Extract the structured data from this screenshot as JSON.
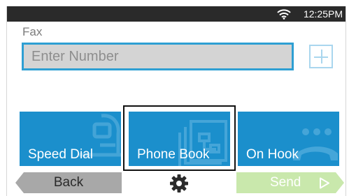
{
  "status_bar": {
    "time": "12:25PM",
    "wifi_icon": "wifi-icon"
  },
  "fax": {
    "label": "Fax",
    "number_placeholder": "Enter Number",
    "number_value": "",
    "add_icon": "plus-icon"
  },
  "tiles": [
    {
      "label": "Speed Dial",
      "icon": "speed-dial-icon"
    },
    {
      "label": "Phone Book",
      "icon": "phone-book-icon",
      "focused": true
    },
    {
      "label": "On Hook",
      "icon": "on-hook-icon"
    }
  ],
  "bottom_bar": {
    "back_label": "Back",
    "settings_icon": "gear-icon",
    "send_label": "Send",
    "send_icon": "play-arrow-icon"
  },
  "colors": {
    "accent": "#2e9fd3",
    "tile": "#1b8fcc",
    "send_disabled": "#c9e8ac",
    "back": "#a8a8a8",
    "status_bar": "#2a2a2a"
  }
}
